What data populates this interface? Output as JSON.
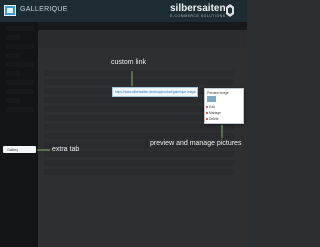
{
  "header": {
    "app_name": "GALLERIQUE",
    "brand": "silbersaiten",
    "brand_sub": "E-COMMERCE SOLUTIONS"
  },
  "custom_link": {
    "url": "https://www.silbersaiten.de/shop/product/galerique-image-gallery-manager"
  },
  "extra_tab": {
    "label": "Gallery"
  },
  "preview": {
    "header": "Preview image",
    "items": [
      "Edit",
      "Manage",
      "Delete"
    ]
  },
  "annotations": {
    "custom_link": "custom link",
    "extra_tab": "extra tab",
    "preview_manage": "preview and manage pictures"
  },
  "colors": {
    "header_bg": "#1d2b33",
    "accent": "#3b9bd8",
    "overlay": "#0c0e10"
  }
}
